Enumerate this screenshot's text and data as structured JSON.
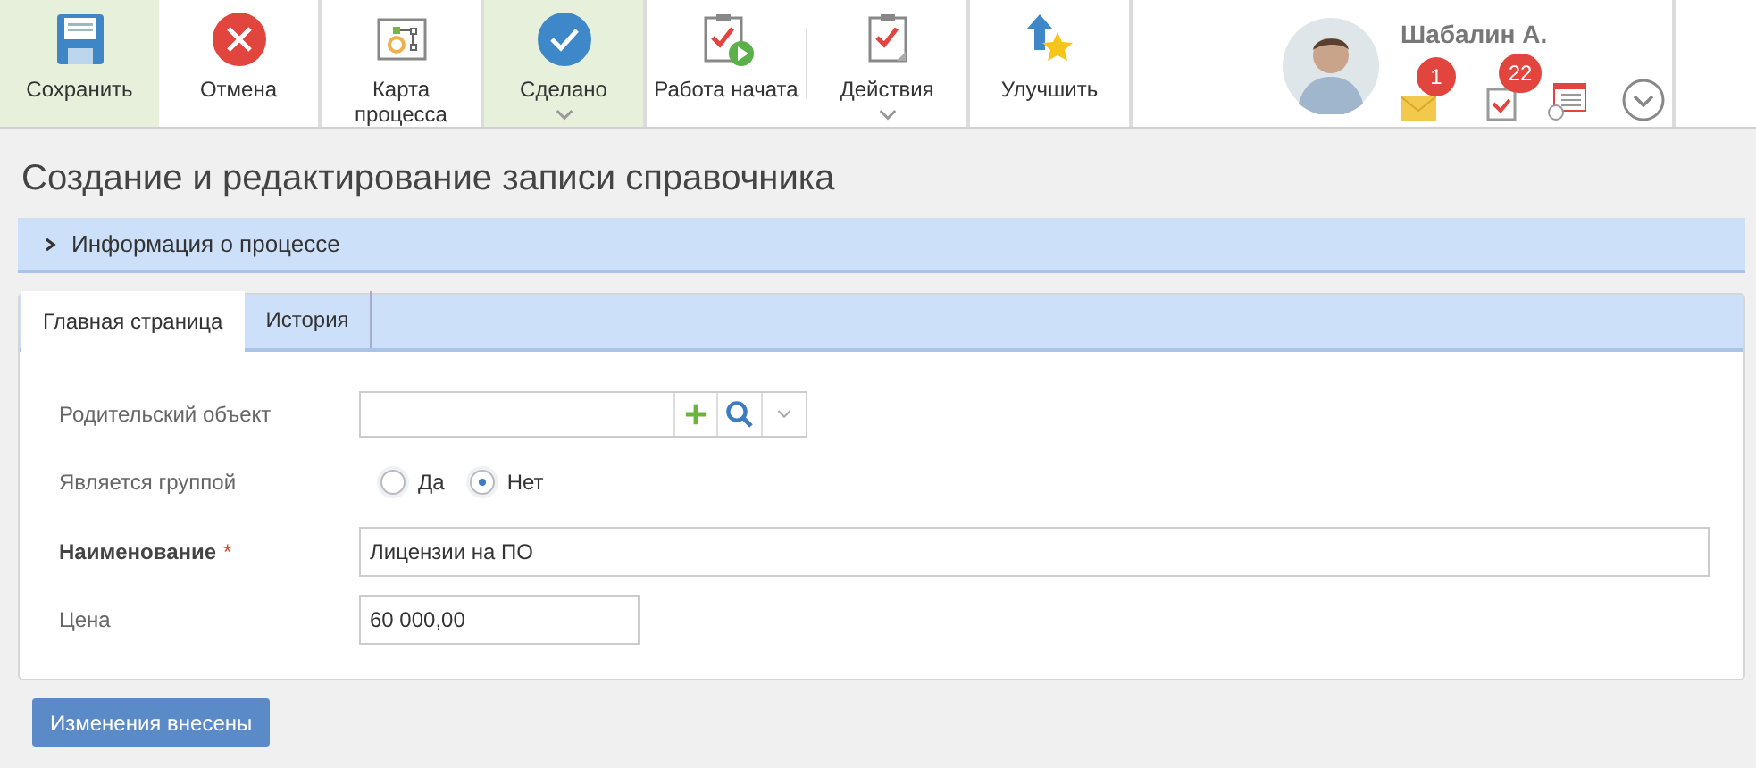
{
  "toolbar": [
    {
      "label": "Сохранить",
      "highlighted": true,
      "has_menu": false,
      "divider_after": false
    },
    {
      "label": "Отмена",
      "highlighted": false,
      "has_menu": false,
      "divider_after": true
    },
    {
      "label": "Карта процесса",
      "highlighted": false,
      "has_menu": false,
      "divider_after": true
    },
    {
      "label": "Сделано",
      "highlighted": true,
      "has_menu": true,
      "divider_after": true
    },
    {
      "label": "Работа начата",
      "highlighted": false,
      "has_menu": false,
      "divider_after": true
    },
    {
      "label": "Действия",
      "highlighted": false,
      "has_menu": true,
      "divider_after": true
    },
    {
      "label": "Улучшить",
      "highlighted": false,
      "has_menu": false,
      "divider_after": true
    }
  ],
  "user": {
    "name": "Шабалин А.",
    "messages_badge": "1",
    "tasks_badge": "22"
  },
  "page_title": "Создание и редактирование записи справочника",
  "process_info": {
    "label": "Информация о процессе",
    "expanded": false
  },
  "tabs": [
    {
      "label": "Главная страница",
      "selected": true
    },
    {
      "label": "История",
      "selected": false
    }
  ],
  "form": {
    "parent": {
      "label": "Родительский объект"
    },
    "is_group": {
      "label": "Является группой",
      "options": [
        {
          "label": "Да",
          "selected": false
        },
        {
          "label": "Нет",
          "selected": true
        }
      ]
    },
    "name": {
      "label": "Наименование",
      "required_mark": "*",
      "value": "Лицензии на ПО"
    },
    "price": {
      "label": "Цена",
      "value": "60 000,00"
    }
  },
  "submit_button": "Изменения внесены"
}
